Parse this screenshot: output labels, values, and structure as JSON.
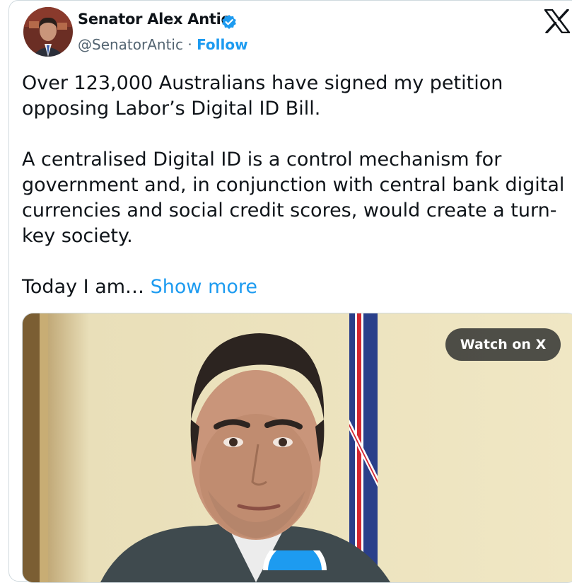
{
  "author": {
    "name": "Senator Alex Antic",
    "handle": "@SenatorAntic",
    "separator": " · ",
    "follow_label": "Follow"
  },
  "tweet": {
    "text": "Over 123,000 Australians have signed my petition\nopposing Labor’s Digital ID Bill.\n\nA centralised Digital ID is a control mechanism for\ngovernment and, in conjunction with central bank digital\ncurrencies and social credit scores, would create a turn-\nkey society.\n\nToday I am… ",
    "show_more": "Show more"
  },
  "media": {
    "watch_label": "Watch on X"
  },
  "icons": {
    "brand": "x-logo-icon",
    "verified": "verified-badge-icon",
    "play": "play-icon"
  },
  "colors": {
    "accent": "#1d9bf0",
    "text": "#0f1419",
    "secondary": "#536471",
    "border": "#cfd9de",
    "watch_button_bg": "#202224"
  }
}
